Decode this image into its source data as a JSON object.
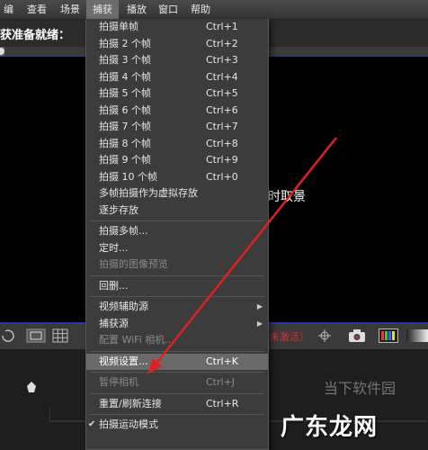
{
  "menubar": {
    "items": [
      {
        "label": "编辑"
      },
      {
        "label": "查看"
      },
      {
        "label": "场景"
      },
      {
        "label": "捕获"
      },
      {
        "label": "播放"
      },
      {
        "label": "窗口"
      },
      {
        "label": "帮助"
      }
    ],
    "active_index": 3
  },
  "status": {
    "title": "捕获准备就绪："
  },
  "live_view_text": "实时取景",
  "warning_text": "未激活）",
  "capture_menu": {
    "groups": [
      [
        {
          "label": "拍摄单帧",
          "shortcut": "Ctrl+1"
        },
        {
          "label": "拍摄 2 个帧",
          "shortcut": "Ctrl+2"
        },
        {
          "label": "拍摄 3 个帧",
          "shortcut": "Ctrl+3"
        },
        {
          "label": "拍摄 4 个帧",
          "shortcut": "Ctrl+4"
        },
        {
          "label": "拍摄 5 个帧",
          "shortcut": "Ctrl+5"
        },
        {
          "label": "拍摄 6 个帧",
          "shortcut": "Ctrl+6"
        },
        {
          "label": "拍摄 7 个帧",
          "shortcut": "Ctrl+7"
        },
        {
          "label": "拍摄 8 个帧",
          "shortcut": "Ctrl+8"
        },
        {
          "label": "拍摄 9 个帧",
          "shortcut": "Ctrl+9"
        },
        {
          "label": "拍摄 10 个帧",
          "shortcut": "Ctrl+0"
        },
        {
          "label": "多帧拍摄作为虚拟存放",
          "shortcut": ""
        },
        {
          "label": "逐步存放",
          "shortcut": ""
        }
      ],
      [
        {
          "label": "拍摄多帧...",
          "shortcut": ""
        },
        {
          "label": "定时...",
          "shortcut": ""
        },
        {
          "label": "拍摄的图像预览",
          "shortcut": "",
          "disabled": true
        }
      ],
      [
        {
          "label": "回删...",
          "shortcut": ""
        }
      ],
      [
        {
          "label": "视频辅助源",
          "shortcut": "",
          "submenu": true
        },
        {
          "label": "捕获源",
          "shortcut": "",
          "submenu": true
        },
        {
          "label": "配置 WiFi 相机...",
          "shortcut": "",
          "disabled": true
        }
      ],
      [
        {
          "label": "视频设置...",
          "shortcut": "Ctrl+K",
          "highlighted": true
        }
      ],
      [
        {
          "label": "暂停相机",
          "shortcut": "Ctrl+J",
          "disabled": true
        }
      ],
      [
        {
          "label": "重置/刷新连接",
          "shortcut": "Ctrl+R"
        }
      ],
      [
        {
          "label": "拍摄运动模式",
          "shortcut": "",
          "checked": true
        }
      ]
    ]
  },
  "watermark": {
    "text": "广东龙网",
    "small_text": "当下软件园"
  },
  "colors": {
    "menu_bg": "#3c3c3c",
    "highlight": "#6a6a6a",
    "arrow": "#e02020",
    "warning": "#d83030"
  }
}
